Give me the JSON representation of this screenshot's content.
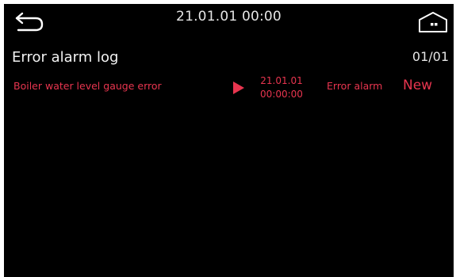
{
  "colors": {
    "background": "#000000",
    "text": "#e6e6e6",
    "alarm": "#e8354f"
  },
  "header": {
    "back_icon": "back-arrow-icon",
    "datetime": "21.01.01 00:00",
    "home_icon": "home-icon"
  },
  "page": {
    "title": "Error alarm log",
    "page_indicator": "01/01"
  },
  "alarm_log": [
    {
      "name": "Boiler water level gauge error",
      "indicator_icon": "play-triangle-icon",
      "date": "21.01.01",
      "time": "00:00:00",
      "type": "Error alarm",
      "status": "New"
    }
  ]
}
